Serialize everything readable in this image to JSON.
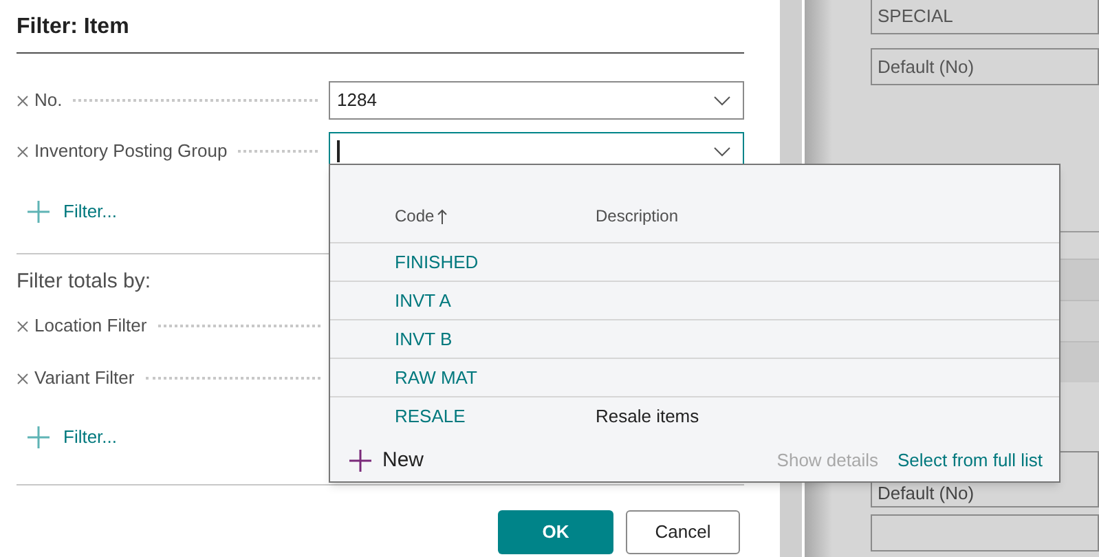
{
  "dialog": {
    "title": "Filter: Item",
    "filters": [
      {
        "label": "No.",
        "value": "1284",
        "focused": false
      },
      {
        "label": "Inventory Posting Group",
        "focused": true
      }
    ],
    "add_filter": "Filter...",
    "totals_heading": "Filter totals by:",
    "total_filters": [
      {
        "label": "Location Filter"
      },
      {
        "label": "Variant Filter"
      }
    ],
    "add_total_filter": "Filter...",
    "buttons": [
      {
        "label": "OK",
        "kind": "primary"
      },
      {
        "label": "Cancel",
        "kind": "secondary"
      }
    ]
  },
  "lookup": {
    "columns": [
      {
        "label": "Code",
        "sorted": true
      },
      {
        "label": "Description",
        "sorted": false
      }
    ],
    "rows": [
      {
        "code": "FINISHED"
      },
      {
        "code": "INVT A"
      },
      {
        "code": "INVT B"
      },
      {
        "code": "RAW MAT"
      },
      {
        "code": "RESALE",
        "description": "Resale items"
      }
    ],
    "new": "New",
    "show_details": {
      "label": "Show details",
      "disabled": true
    },
    "select_full": "Select from full list"
  },
  "background": {
    "top_fields": [
      {
        "value": "SPECIAL"
      },
      {
        "value": "Default (No)"
      }
    ],
    "bottom_fields": [
      {
        "value": "Default (No)"
      }
    ]
  }
}
